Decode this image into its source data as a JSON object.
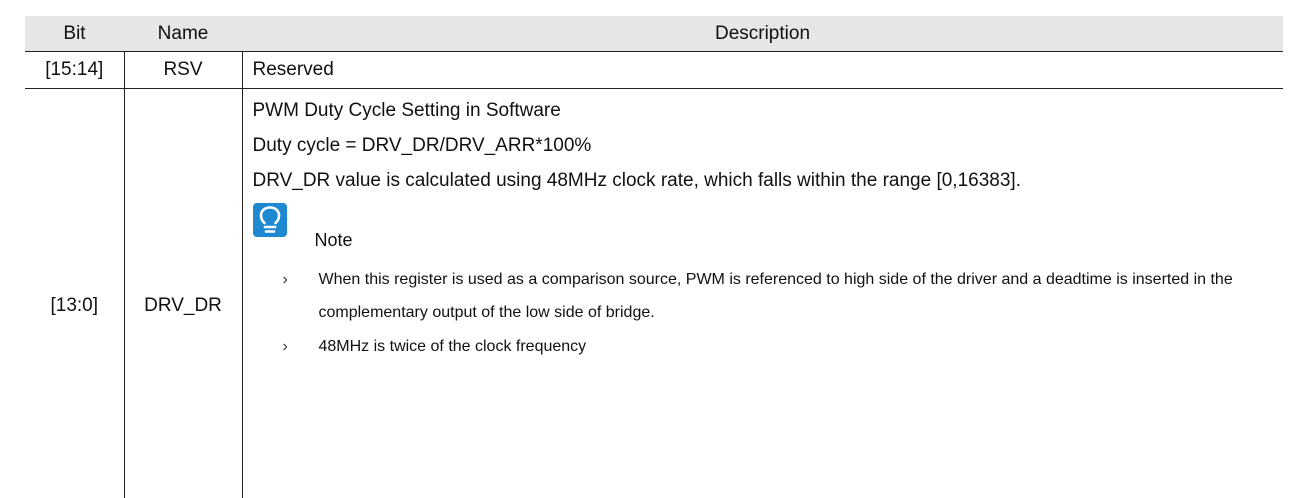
{
  "table": {
    "headers": {
      "bit": "Bit",
      "name": "Name",
      "description": "Description"
    },
    "rows": [
      {
        "bit": "[15:14]",
        "name": "RSV",
        "description": "Reserved"
      },
      {
        "bit": "[13:0]",
        "name": "DRV_DR",
        "description_lines": [
          "PWM Duty Cycle Setting in Software",
          "Duty cycle = DRV_DR/DRV_ARR*100%",
          "DRV_DR value is calculated using 48MHz clock rate, which falls within the range [0,16383]."
        ],
        "note": {
          "icon": "lightbulb-icon",
          "title": "Note",
          "items": [
            "When this register is used as a comparison source, PWM is referenced to high side of the driver and a deadtime is inserted in the complementary output of the low side of bridge.",
            "48MHz is twice of the clock frequency"
          ],
          "bullet": "›"
        }
      }
    ]
  },
  "colors": {
    "header_bg": "#e6e6e6",
    "icon_bg": "#1e88d0",
    "rule": "#222222"
  }
}
